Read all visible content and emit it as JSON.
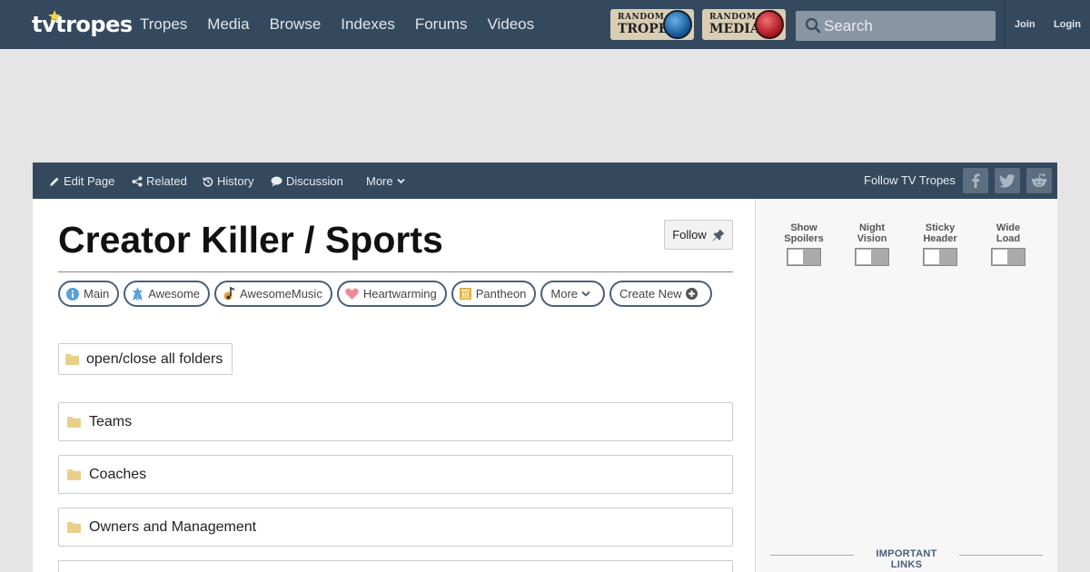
{
  "logo": {
    "text_part1": "tv",
    "text_part2": "tropes"
  },
  "nav": {
    "links": [
      "Tropes",
      "Media",
      "Browse",
      "Indexes",
      "Forums",
      "Videos"
    ],
    "random_trope": {
      "line1": "RANDOM",
      "line2": "TROPE"
    },
    "random_media": {
      "line1": "RANDOM",
      "line2": "MEDIA"
    },
    "search_placeholder": "Search",
    "join": "Join",
    "login": "Login"
  },
  "actionbar": {
    "edit_page": "Edit Page",
    "related": "Related",
    "history": "History",
    "discussion": "Discussion",
    "more": "More",
    "follow_tv_tropes": "Follow TV Tropes"
  },
  "page": {
    "title_prefix": "Creator Killer / ",
    "title_bold": "Sports",
    "follow_button": "Follow"
  },
  "pills": [
    "Main",
    "Awesome",
    "AwesomeMusic",
    "Heartwarming",
    "Pantheon",
    "More",
    "Create New"
  ],
  "open_close_label": "open/close all folders",
  "folders": [
    "Teams",
    "Coaches",
    "Owners and Management"
  ],
  "sidebar": {
    "toggles": [
      {
        "line1": "Show",
        "line2": "Spoilers"
      },
      {
        "line1": "Night",
        "line2": "Vision"
      },
      {
        "line1": "Sticky",
        "line2": "Header"
      },
      {
        "line1": "Wide",
        "line2": "Load"
      }
    ],
    "important_links": "IMPORTANT LINKS"
  },
  "colors": {
    "nav_bg": "#34495e",
    "pill_border": "#4a6076",
    "folder_icon": "#e8d08a",
    "page_bg": "#e5e5e5"
  }
}
